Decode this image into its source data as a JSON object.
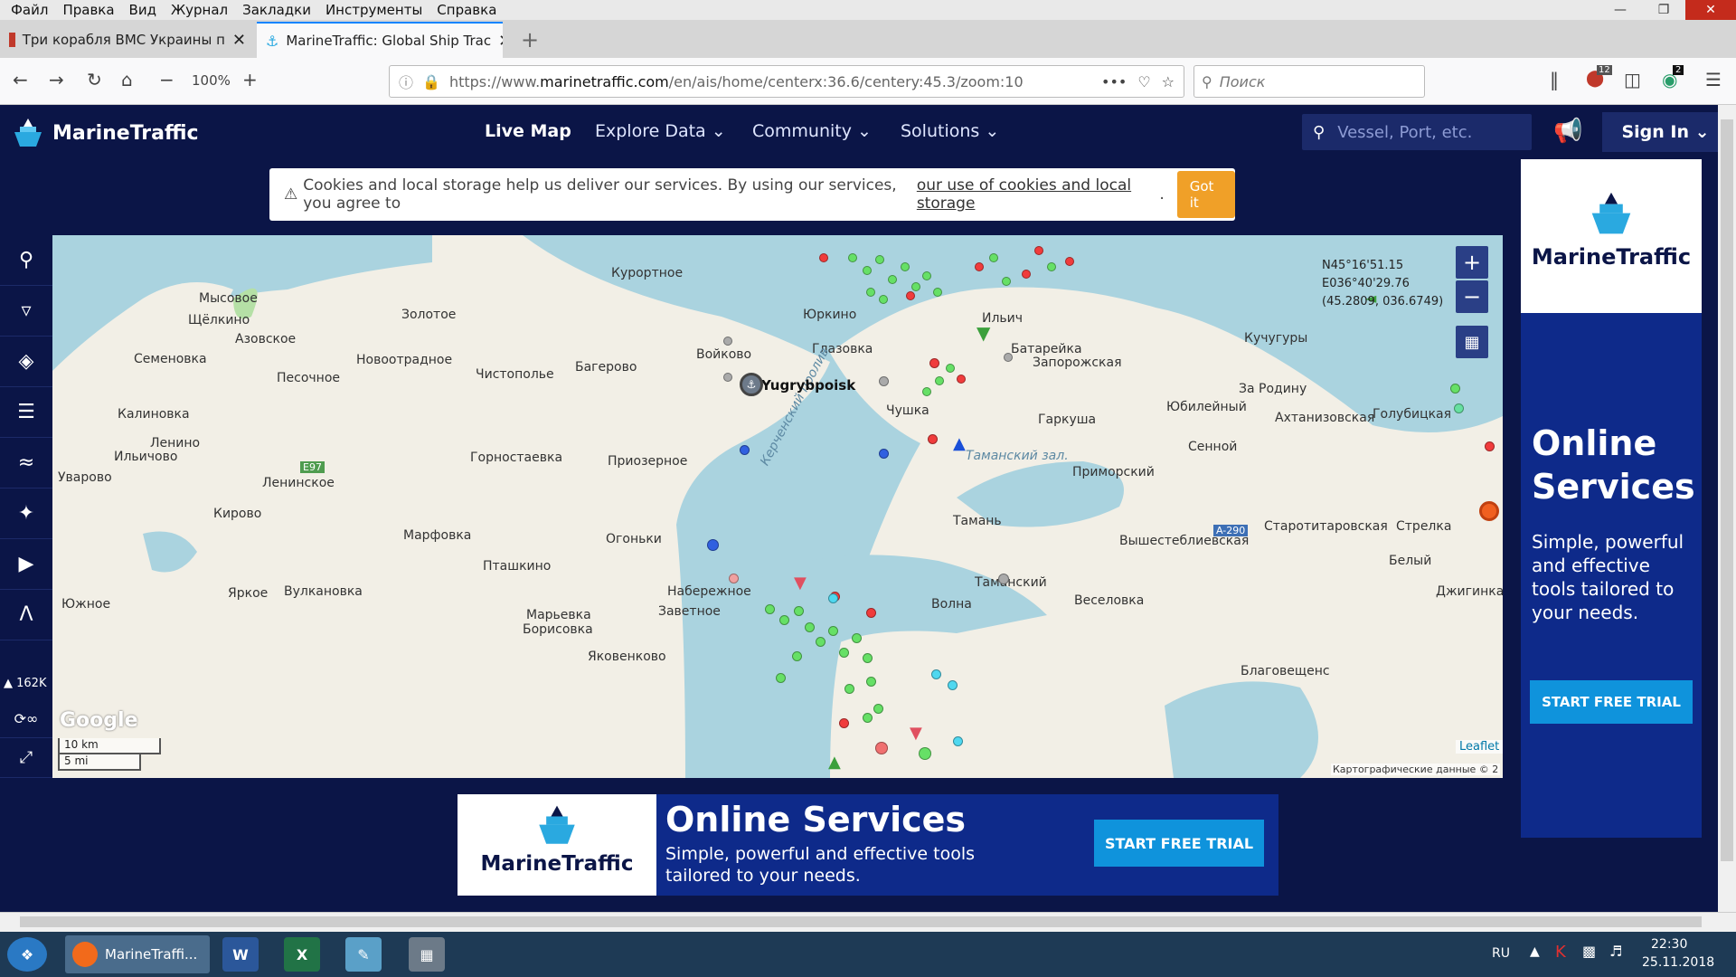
{
  "browser": {
    "menu": [
      "Файл",
      "Правка",
      "Вид",
      "Журнал",
      "Закладки",
      "Инструменты",
      "Справка"
    ],
    "tabs": [
      {
        "label": "Три корабля ВМС Украины п"
      },
      {
        "label": "MarineTraffic: Global Ship Trac"
      }
    ],
    "new_tab": "+",
    "zoom": "100%",
    "url_prefix": "https://www.",
    "url_host": "marinetraffic.com",
    "url_path": "/en/ais/home/centerx:36.6/centery:45.3/zoom:10",
    "search_placeholder": "Поиск",
    "badges": {
      "abp": "12",
      "ext": "2"
    }
  },
  "site": {
    "logo": "MarineTraffic",
    "nav": {
      "live_map": "Live Map",
      "explore": "Explore Data",
      "community": "Community",
      "solutions": "Solutions"
    },
    "search_placeholder": "Vessel, Port, etc.",
    "sign_in": "Sign In",
    "cookie": {
      "text": "Cookies and local storage help us deliver our services. By using our services, you agree to",
      "link": "our use of cookies and local storage",
      "got_it": "Got it"
    },
    "vessel_count": "162K"
  },
  "map": {
    "coords": {
      "lat": "N45°16'51.15",
      "lon": "E036°40'29.76",
      "dec": "(45.2809, 036.6749)"
    },
    "scale": {
      "km": "10 km",
      "mi": "5 mi"
    },
    "leaflet": "Leaflet",
    "attribution": "Картографические данные © 2",
    "google": "Google",
    "vessel_label": "Yugrybpoisk",
    "places": [
      "Мысовое",
      "Щёлкино",
      "Азовское",
      "Семеновка",
      "Калиновка",
      "Ленино",
      "Ильичово",
      "Уварово",
      "Золотое",
      "Курортное",
      "Новоотрадное",
      "Песочное",
      "Чистополье",
      "Багерово",
      "Войково",
      "Юркино",
      "Глазовка",
      "Ильич",
      "Кучугуры",
      "Батарейка",
      "Запорожская",
      "Чушка",
      "Гаркуша",
      "Юбилейный",
      "Ахтанизовская",
      "За Родину",
      "Голубицкая",
      "Сенной",
      "Таманский зал.",
      "Приморский",
      "Тамань",
      "Вышестеблиевская",
      "Старотитаровская",
      "Стрелка",
      "Белый",
      "Таманский",
      "Веселовка",
      "Джигинка",
      "Волна",
      "Ленинское",
      "Горностаевка",
      "Приозерное",
      "Кирово",
      "Марфовка",
      "Огоньки",
      "Пташкино",
      "Яркое",
      "Вулкановка",
      "Южное",
      "Набережное",
      "Заветное",
      "Марьевка",
      "Борисовка",
      "Яковенково",
      "Благовещенс",
      "Керченский пролив",
      "E97",
      "A-290"
    ]
  },
  "ads": {
    "brand": "MarineTraffic",
    "headline": "Online Services",
    "sub_right": "Simple, powerful and effective tools tailored to your needs.",
    "sub_bottom": "Simple, powerful and effective tools tailored to your needs.",
    "cta": "START FREE TRIAL"
  },
  "taskbar": {
    "app_label": "MarineTraffi...",
    "lang": "RU",
    "time": "22:30",
    "date": "25.11.2018"
  }
}
